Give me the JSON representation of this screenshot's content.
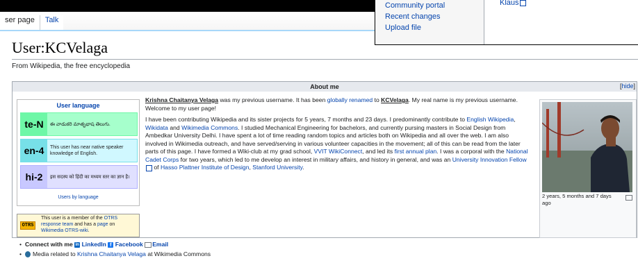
{
  "tabs": {
    "user_page": "ser page",
    "talk": "Talk"
  },
  "page": {
    "title": "User:KCVelaga",
    "tagline": "From Wikipedia, the free encyclopedia"
  },
  "about": {
    "header": "About me",
    "hide": "hide",
    "userboxes": {
      "heading": "User language",
      "items": [
        {
          "code": "te-N",
          "text": "ఈ వాడుకరి మాతృభాష తెలుగు.",
          "color": "#77e0e8",
          "bg": "#a6ffcc"
        },
        {
          "code": "en-4",
          "text": "This user has near native speaker knowledge of English.",
          "color": "#77e0e8",
          "bg": "#d0f8ff"
        },
        {
          "code": "hi-2",
          "text": "इस सदस्य को हिंदी का मध्यम स्तर का ज्ञान है।",
          "color": "#b0b0ff",
          "bg": "#e0e0ff"
        }
      ],
      "footer": "Users by language"
    },
    "otrs": {
      "logo": "OTRS",
      "text_a": "This user is a member of the ",
      "link_a": "OTRS response team",
      "text_b": " and has a ",
      "link_b": "page",
      "text_c": " on ",
      "link_c": "Wikimedia OTRS-wiki",
      "text_d": "."
    },
    "bio": {
      "p1_name": "Krishna Chaitanya Velaga",
      "p1_a": " was my previous username. It has been ",
      "p1_link": "globally renamed",
      "p1_b": " to ",
      "p1_user": "KCVelaga",
      "p1_c": ". My real name is my previous username. Welcome to my user page!",
      "p2_a": "I have been contributing Wikipedia and its sister projects for 5 years, 7 months and 23 days. I predominantly contribute to ",
      "p2_link1": "English Wikipedia",
      "p2_b": ", ",
      "p2_link2": "Wikidata",
      "p2_c": " and ",
      "p2_link3": "Wikimedia Commons",
      "p2_d": ". I studied Mechanical Engineering for bachelors, and currently pursing masters in Social Design from Ambedkar University Delhi. I have spent a lot of time reading random topics and articles both on Wikipedia and all over the web. I am also involved in Wikimedia outreach, and have served/serving in various volunteer capacities in the movement; all of this can be read from the later parts of this page. I have formed a Wiki-club at my grad school, ",
      "p2_link4": "VVIT WikiConnect",
      "p2_e": ", and led its ",
      "p2_link5": "first annual plan",
      "p2_f": ". I was a corporal with the ",
      "p2_link6": "National Cadet Corps",
      "p2_g": " for two years, which led to me develop an interest in military affairs, and history in general, and was an ",
      "p2_link7": "University Innovation Fellow",
      "p2_h": " of ",
      "p2_link8": "Hasso Plattner Institute of Design",
      "p2_i": ", ",
      "p2_link9": "Stanford University",
      "p2_j": "."
    },
    "photo_caption": "2 years, 5 months and 7 days ago"
  },
  "bullets": {
    "connect_label": "Connect with me",
    "linkedin": "LinkedIn",
    "facebook": "Facebook",
    "email": "Email",
    "media_a": "Media related to ",
    "media_link": "Krishna Chaitanya Velaga",
    "media_b": " at Wikimedia Commons"
  },
  "popup": {
    "sidebar": [
      "Community portal",
      "Recent changes",
      "Upload file"
    ],
    "right_link": "Klaus"
  }
}
